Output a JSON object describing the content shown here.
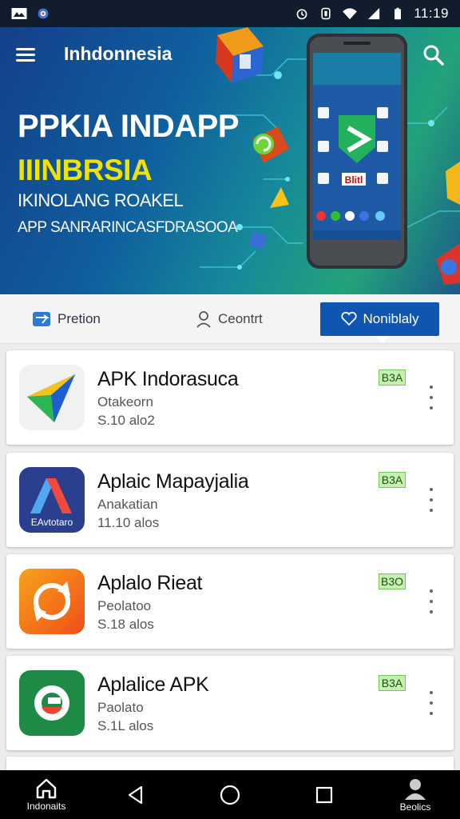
{
  "status_bar": {
    "time": "11:19"
  },
  "app_bar": {
    "title": "Inhdonnesia"
  },
  "hero": {
    "title": "PPKIA INDAPP",
    "subtitle": "IIINBRSIA",
    "line1": "IKINOLANG ROAKEL",
    "line2": "APP SANRARINCASFDRASOOA",
    "phone_banner": "Blitl",
    "colors": {
      "subtitle": "#f2e200"
    }
  },
  "tabs": [
    {
      "label": "Pretion",
      "icon": "plane-icon"
    },
    {
      "label": "Ceontrt",
      "icon": "user-icon"
    },
    {
      "label": "Noniblaly",
      "icon": "heart-icon",
      "active": true
    }
  ],
  "apps": [
    {
      "name": "APK Indorasuca",
      "developer": "Otakeorn",
      "size": "S.10 alo2",
      "badge": "B3A",
      "icon": "compass-icon"
    },
    {
      "name": "Aplaic Mapayjalia",
      "developer": "Anakatian",
      "size": "11.10 alos",
      "badge": "B3A",
      "icon": "letter-a-icon",
      "icon_caption": "EAvtotaro"
    },
    {
      "name": "Aplalo Rieat",
      "developer": "Peolatoo",
      "size": "S.18 alos",
      "badge": "B3O",
      "icon": "refresh-icon"
    },
    {
      "name": "Aplalice APK",
      "developer": "Paolato",
      "size": "S.1L alos",
      "badge": "B3A",
      "icon": "sync-icon"
    }
  ],
  "nav": {
    "home_label": "Indonaits",
    "profile_label": "Beolics"
  }
}
